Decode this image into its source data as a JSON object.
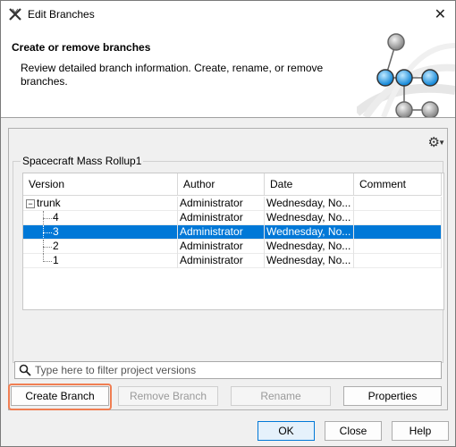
{
  "window": {
    "title": "Edit Branches",
    "close_glyph": "✕"
  },
  "header": {
    "title": "Create or remove branches",
    "description": "Review detailed branch information. Create, rename, or remove branches."
  },
  "panel": {
    "group_label": "Spacecraft Mass Rollup1",
    "columns": [
      "Version",
      "Author",
      "Date",
      "Comment"
    ],
    "rows": [
      {
        "version": "trunk",
        "author": "Administrator",
        "date": "Wednesday, No...",
        "comment": ""
      },
      {
        "version": "4",
        "author": "Administrator",
        "date": "Wednesday, No...",
        "comment": ""
      },
      {
        "version": "3",
        "author": "Administrator",
        "date": "Wednesday, No...",
        "comment": ""
      },
      {
        "version": "2",
        "author": "Administrator",
        "date": "Wednesday, No...",
        "comment": ""
      },
      {
        "version": "1",
        "author": "Administrator",
        "date": "Wednesday, No...",
        "comment": ""
      }
    ],
    "filter_placeholder": "Type here to filter project versions"
  },
  "buttons": {
    "create_branch": "Create Branch",
    "remove_branch": "Remove Branch",
    "rename": "Rename",
    "properties": "Properties",
    "ok": "OK",
    "close": "Close",
    "help": "Help"
  },
  "colors": {
    "selection": "#0078d7",
    "highlight": "#f07e52"
  }
}
